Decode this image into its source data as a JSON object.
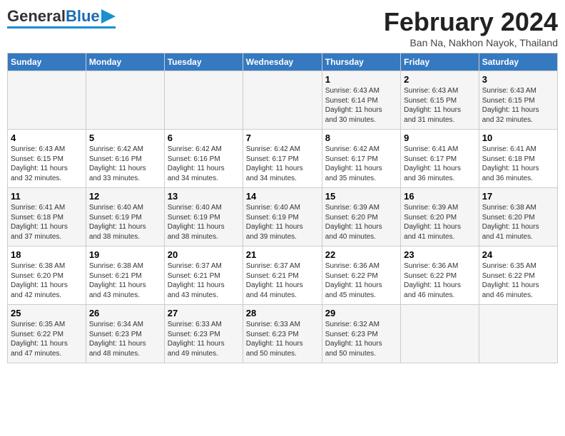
{
  "header": {
    "logo_general": "General",
    "logo_blue": "Blue",
    "month_year": "February 2024",
    "location": "Ban Na, Nakhon Nayok, Thailand"
  },
  "days_of_week": [
    "Sunday",
    "Monday",
    "Tuesday",
    "Wednesday",
    "Thursday",
    "Friday",
    "Saturday"
  ],
  "weeks": [
    [
      {
        "day": "",
        "info": ""
      },
      {
        "day": "",
        "info": ""
      },
      {
        "day": "",
        "info": ""
      },
      {
        "day": "",
        "info": ""
      },
      {
        "day": "1",
        "info": "Sunrise: 6:43 AM\nSunset: 6:14 PM\nDaylight: 11 hours\nand 30 minutes."
      },
      {
        "day": "2",
        "info": "Sunrise: 6:43 AM\nSunset: 6:15 PM\nDaylight: 11 hours\nand 31 minutes."
      },
      {
        "day": "3",
        "info": "Sunrise: 6:43 AM\nSunset: 6:15 PM\nDaylight: 11 hours\nand 32 minutes."
      }
    ],
    [
      {
        "day": "4",
        "info": "Sunrise: 6:43 AM\nSunset: 6:15 PM\nDaylight: 11 hours\nand 32 minutes."
      },
      {
        "day": "5",
        "info": "Sunrise: 6:42 AM\nSunset: 6:16 PM\nDaylight: 11 hours\nand 33 minutes."
      },
      {
        "day": "6",
        "info": "Sunrise: 6:42 AM\nSunset: 6:16 PM\nDaylight: 11 hours\nand 34 minutes."
      },
      {
        "day": "7",
        "info": "Sunrise: 6:42 AM\nSunset: 6:17 PM\nDaylight: 11 hours\nand 34 minutes."
      },
      {
        "day": "8",
        "info": "Sunrise: 6:42 AM\nSunset: 6:17 PM\nDaylight: 11 hours\nand 35 minutes."
      },
      {
        "day": "9",
        "info": "Sunrise: 6:41 AM\nSunset: 6:17 PM\nDaylight: 11 hours\nand 36 minutes."
      },
      {
        "day": "10",
        "info": "Sunrise: 6:41 AM\nSunset: 6:18 PM\nDaylight: 11 hours\nand 36 minutes."
      }
    ],
    [
      {
        "day": "11",
        "info": "Sunrise: 6:41 AM\nSunset: 6:18 PM\nDaylight: 11 hours\nand 37 minutes."
      },
      {
        "day": "12",
        "info": "Sunrise: 6:40 AM\nSunset: 6:19 PM\nDaylight: 11 hours\nand 38 minutes."
      },
      {
        "day": "13",
        "info": "Sunrise: 6:40 AM\nSunset: 6:19 PM\nDaylight: 11 hours\nand 38 minutes."
      },
      {
        "day": "14",
        "info": "Sunrise: 6:40 AM\nSunset: 6:19 PM\nDaylight: 11 hours\nand 39 minutes."
      },
      {
        "day": "15",
        "info": "Sunrise: 6:39 AM\nSunset: 6:20 PM\nDaylight: 11 hours\nand 40 minutes."
      },
      {
        "day": "16",
        "info": "Sunrise: 6:39 AM\nSunset: 6:20 PM\nDaylight: 11 hours\nand 41 minutes."
      },
      {
        "day": "17",
        "info": "Sunrise: 6:38 AM\nSunset: 6:20 PM\nDaylight: 11 hours\nand 41 minutes."
      }
    ],
    [
      {
        "day": "18",
        "info": "Sunrise: 6:38 AM\nSunset: 6:20 PM\nDaylight: 11 hours\nand 42 minutes."
      },
      {
        "day": "19",
        "info": "Sunrise: 6:38 AM\nSunset: 6:21 PM\nDaylight: 11 hours\nand 43 minutes."
      },
      {
        "day": "20",
        "info": "Sunrise: 6:37 AM\nSunset: 6:21 PM\nDaylight: 11 hours\nand 43 minutes."
      },
      {
        "day": "21",
        "info": "Sunrise: 6:37 AM\nSunset: 6:21 PM\nDaylight: 11 hours\nand 44 minutes."
      },
      {
        "day": "22",
        "info": "Sunrise: 6:36 AM\nSunset: 6:22 PM\nDaylight: 11 hours\nand 45 minutes."
      },
      {
        "day": "23",
        "info": "Sunrise: 6:36 AM\nSunset: 6:22 PM\nDaylight: 11 hours\nand 46 minutes."
      },
      {
        "day": "24",
        "info": "Sunrise: 6:35 AM\nSunset: 6:22 PM\nDaylight: 11 hours\nand 46 minutes."
      }
    ],
    [
      {
        "day": "25",
        "info": "Sunrise: 6:35 AM\nSunset: 6:22 PM\nDaylight: 11 hours\nand 47 minutes."
      },
      {
        "day": "26",
        "info": "Sunrise: 6:34 AM\nSunset: 6:23 PM\nDaylight: 11 hours\nand 48 minutes."
      },
      {
        "day": "27",
        "info": "Sunrise: 6:33 AM\nSunset: 6:23 PM\nDaylight: 11 hours\nand 49 minutes."
      },
      {
        "day": "28",
        "info": "Sunrise: 6:33 AM\nSunset: 6:23 PM\nDaylight: 11 hours\nand 50 minutes."
      },
      {
        "day": "29",
        "info": "Sunrise: 6:32 AM\nSunset: 6:23 PM\nDaylight: 11 hours\nand 50 minutes."
      },
      {
        "day": "",
        "info": ""
      },
      {
        "day": "",
        "info": ""
      }
    ]
  ]
}
